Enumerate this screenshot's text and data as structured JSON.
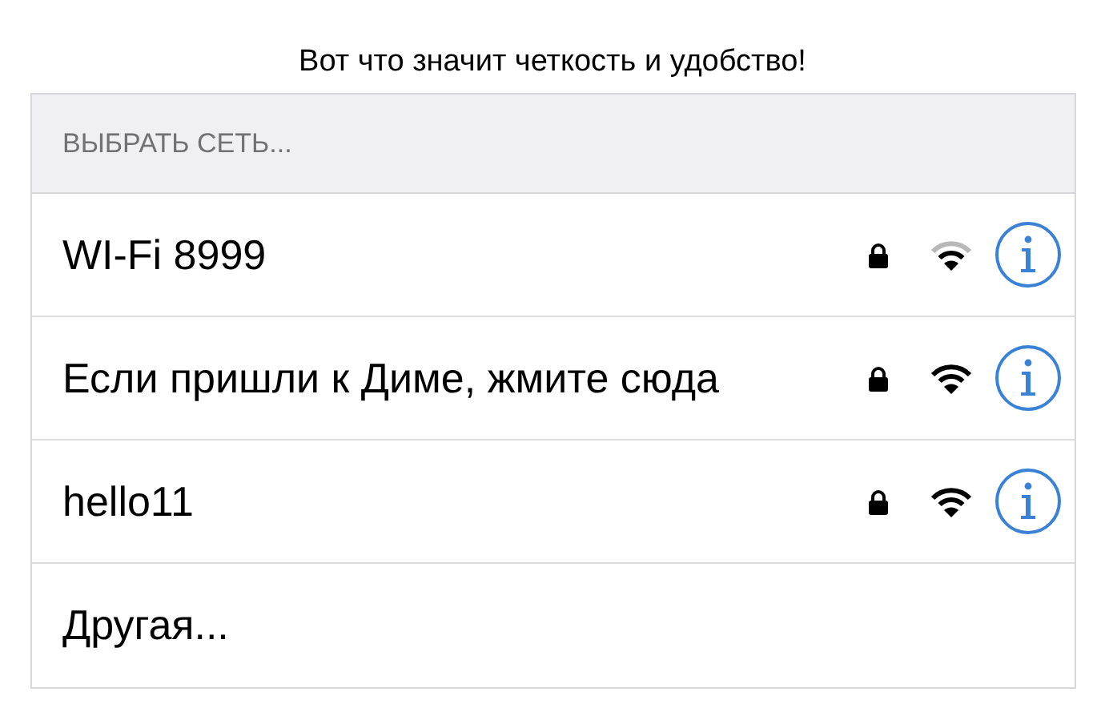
{
  "caption": "Вот что значит четкость и удобство!",
  "section_header": "ВЫБРАТЬ СЕТЬ...",
  "networks": [
    {
      "name": "WI-Fi 8999",
      "kind": "network",
      "locked": true,
      "weak_signal": true
    },
    {
      "name": "Если пришли к Диме, жмите сюда",
      "kind": "network",
      "locked": true,
      "weak_signal": false
    },
    {
      "name": "hello11",
      "kind": "network",
      "locked": true,
      "weak_signal": false
    },
    {
      "name": "Другая...",
      "kind": "other"
    }
  ]
}
